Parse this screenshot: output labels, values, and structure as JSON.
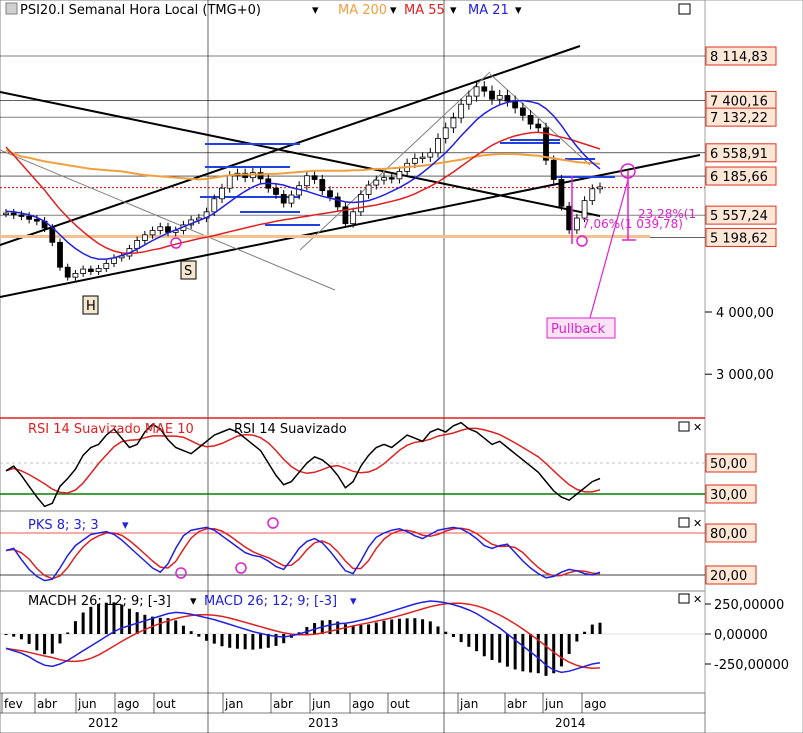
{
  "main_panel": {
    "title": "PSI20.I Semanal Hora Local (TMG+0)",
    "legend": [
      {
        "label": "MA 200",
        "color": "#f0a040"
      },
      {
        "label": "MA 55",
        "color": "#e02020"
      },
      {
        "label": "MA 21",
        "color": "#2020e0"
      }
    ],
    "price_labels": [
      {
        "value": 8114.83,
        "text": "8 114,83"
      },
      {
        "value": 7400.16,
        "text": "7 400,16"
      },
      {
        "value": 7132.22,
        "text": "7 132,22"
      },
      {
        "value": 6558.91,
        "text": "6 558,91"
      },
      {
        "value": 6185.66,
        "text": "6 185,66"
      },
      {
        "value": 5557.24,
        "text": "5 557,24"
      },
      {
        "value": 5198.62,
        "text": "5 198,62"
      }
    ],
    "axis_ticks": [
      {
        "value": 4000,
        "text": "4 000,00"
      },
      {
        "value": 3000,
        "text": "3 000,00"
      }
    ],
    "annotations": {
      "h_label": "H",
      "s_label": "S",
      "pullback_label": "Pullback",
      "pct1": "23,28%(1",
      "pct2": "7,06%(1 039,78)"
    }
  },
  "rsi_panel": {
    "legend_1": "RSI 14 Suavizado MAE 10",
    "legend_2": "RSI 14 Suavizado",
    "levels": [
      {
        "value": 50,
        "text": "50,00"
      },
      {
        "value": 30,
        "text": "30,00"
      }
    ]
  },
  "pks_panel": {
    "legend": "PKS 8; 3; 3",
    "levels": [
      {
        "value": 80,
        "text": "80,00"
      },
      {
        "value": 20,
        "text": "20,00"
      }
    ]
  },
  "macd_panel": {
    "legend_1": "MACDH 26; 12; 9; [-3]",
    "legend_2": "MACD 26; 12; 9; [-3]",
    "ticks": [
      {
        "value": 250000,
        "text": "250,00000"
      },
      {
        "value": 0,
        "text": "0,00000"
      },
      {
        "value": -250000,
        "text": "-250,00000"
      }
    ]
  },
  "time_axis": {
    "months": [
      "fev",
      "abr",
      "jun",
      "ago",
      "out",
      "jan",
      "abr",
      "jun",
      "ago",
      "out",
      "jan",
      "abr",
      "jun",
      "ago"
    ],
    "years": [
      "2012",
      "2013",
      "2014"
    ]
  },
  "colors": {
    "candle_up": "#ffffff",
    "candle_down": "#000000",
    "ma200": "#f0a040",
    "ma55": "#e02020",
    "ma21": "#2020e0",
    "annotation": "#e020d0",
    "label_box": "#fde8d8",
    "label_border": "#e03020"
  },
  "chart_data": {
    "type": "line",
    "title": "PSI20.I Semanal Hora Local (TMG+0)",
    "series_close": [
      5590,
      5560,
      5540,
      5490,
      5460,
      5350,
      5120,
      4720,
      4560,
      4620,
      4690,
      4650,
      4700,
      4780,
      4870,
      4900,
      5020,
      5150,
      5240,
      5310,
      5370,
      5280,
      5310,
      5400,
      5480,
      5510,
      5610,
      5820,
      5990,
      6190,
      6230,
      6160,
      6240,
      6140,
      5990,
      5890,
      5750,
      5880,
      6030,
      6190,
      6130,
      5950,
      5850,
      5690,
      5420,
      5610,
      5890,
      6040,
      6120,
      6160,
      6140,
      6260,
      6390,
      6470,
      6490,
      6560,
      6790,
      6960,
      7120,
      7340,
      7470,
      7620,
      7550,
      7420,
      7480,
      7390,
      7280,
      7160,
      7020,
      6960,
      6440,
      6130,
      5700,
      5320,
      5510,
      5790,
      5980,
      6010
    ],
    "ma200": [
      6600,
      6550,
      6500,
      6480,
      6450,
      6420,
      6400,
      6380,
      6360,
      6340,
      6320,
      6300,
      6290,
      6280,
      6270,
      6260,
      6240,
      6220,
      6200,
      6190,
      6180,
      6170,
      6160,
      6150,
      6140,
      6130,
      6140,
      6160,
      6180,
      6200,
      6210,
      6210,
      6210,
      6210,
      6220,
      6220,
      6230,
      6240,
      6250,
      6260,
      6270,
      6270,
      6270,
      6270,
      6270,
      6280,
      6280,
      6290,
      6300,
      6300,
      6310,
      6320,
      6330,
      6340,
      6350,
      6370,
      6390,
      6410,
      6430,
      6450,
      6480,
      6500,
      6520,
      6530,
      6540,
      6540,
      6540,
      6530,
      6520,
      6510,
      6490,
      6470,
      6450,
      6430,
      6410,
      6400,
      6390,
      6380
    ],
    "ma55": [
      6650,
      6520,
      6380,
      6240,
      6100,
      5960,
      5800,
      5650,
      5520,
      5400,
      5290,
      5190,
      5100,
      5030,
      4980,
      4950,
      4940,
      4950,
      4970,
      5000,
      5020,
      5060,
      5090,
      5120,
      5150,
      5180,
      5200,
      5230,
      5260,
      5290,
      5320,
      5350,
      5380,
      5410,
      5430,
      5460,
      5480,
      5500,
      5520,
      5540,
      5560,
      5580,
      5600,
      5620,
      5640,
      5660,
      5680,
      5700,
      5720,
      5750,
      5780,
      5810,
      5850,
      5900,
      5960,
      6020,
      6090,
      6170,
      6250,
      6340,
      6430,
      6520,
      6600,
      6680,
      6740,
      6790,
      6830,
      6860,
      6880,
      6890,
      6870,
      6840,
      6810,
      6780,
      6740,
      6700,
      6660,
      6620
    ],
    "ma21": [
      5620,
      5610,
      5590,
      5560,
      5520,
      5460,
      5360,
      5240,
      5120,
      5020,
      4940,
      4880,
      4850,
      4850,
      4870,
      4910,
      4950,
      5010,
      5080,
      5150,
      5210,
      5270,
      5320,
      5370,
      5420,
      5470,
      5520,
      5590,
      5680,
      5770,
      5860,
      5940,
      6010,
      6060,
      6070,
      6060,
      6040,
      6000,
      5970,
      5940,
      5900,
      5860,
      5830,
      5800,
      5770,
      5760,
      5770,
      5790,
      5830,
      5880,
      5940,
      6000,
      6070,
      6150,
      6240,
      6340,
      6450,
      6560,
      6690,
      6830,
      6960,
      7090,
      7190,
      7270,
      7330,
      7370,
      7390,
      7400,
      7380,
      7350,
      7270,
      7150,
      7000,
      6820,
      6660,
      6520,
      6400,
      6300
    ],
    "rsi": [
      45,
      48,
      42,
      35,
      28,
      22,
      24,
      35,
      40,
      46,
      55,
      60,
      62,
      68,
      72,
      66,
      60,
      62,
      70,
      75,
      72,
      65,
      60,
      58,
      56,
      60,
      64,
      68,
      70,
      72,
      70,
      66,
      62,
      58,
      50,
      42,
      36,
      38,
      44,
      50,
      54,
      52,
      48,
      42,
      34,
      38,
      48,
      55,
      60,
      62,
      60,
      64,
      68,
      66,
      64,
      70,
      72,
      70,
      74,
      76,
      72,
      70,
      66,
      62,
      64,
      60,
      56,
      52,
      48,
      44,
      38,
      32,
      28,
      26,
      30,
      34,
      38,
      40
    ],
    "pks": [
      55,
      58,
      42,
      28,
      18,
      12,
      14,
      30,
      48,
      62,
      70,
      78,
      80,
      82,
      78,
      70,
      60,
      50,
      40,
      30,
      24,
      36,
      58,
      76,
      84,
      86,
      88,
      84,
      76,
      68,
      60,
      52,
      48,
      46,
      40,
      32,
      28,
      42,
      58,
      68,
      72,
      66,
      54,
      40,
      26,
      22,
      40,
      60,
      74,
      80,
      84,
      86,
      82,
      76,
      72,
      78,
      84,
      86,
      88,
      86,
      80,
      72,
      62,
      58,
      62,
      64,
      52,
      40,
      30,
      22,
      16,
      18,
      24,
      28,
      26,
      22,
      20,
      24
    ],
    "macd": [
      -120000,
      -140000,
      -160000,
      -190000,
      -230000,
      -260000,
      -270000,
      -250000,
      -220000,
      -180000,
      -140000,
      -100000,
      -60000,
      -20000,
      20000,
      50000,
      70000,
      90000,
      110000,
      130000,
      150000,
      170000,
      180000,
      175000,
      165000,
      150000,
      135000,
      120000,
      100000,
      80000,
      60000,
      40000,
      20000,
      5000,
      -10000,
      -20000,
      -25000,
      -15000,
      0,
      20000,
      40000,
      60000,
      75000,
      85000,
      90000,
      100000,
      115000,
      130000,
      150000,
      170000,
      190000,
      210000,
      230000,
      250000,
      265000,
      275000,
      270000,
      260000,
      245000,
      225000,
      200000,
      170000,
      130000,
      90000,
      50000,
      0,
      -50000,
      -100000,
      -150000,
      -200000,
      -260000,
      -300000,
      -320000,
      -310000,
      -290000,
      -270000,
      -250000,
      -240000
    ]
  }
}
